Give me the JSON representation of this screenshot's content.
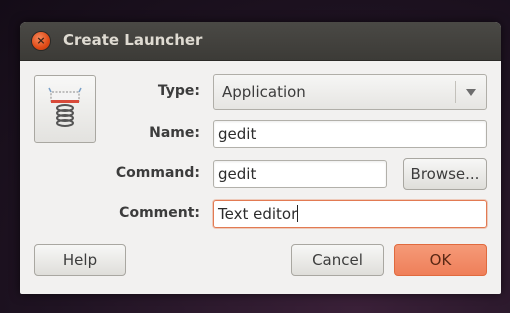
{
  "window": {
    "title": "Create Launcher",
    "close_glyph": "×"
  },
  "form": {
    "type_label": "Type:",
    "type_value": "Application",
    "name_label": "Name:",
    "name_value": "gedit",
    "command_label": "Command:",
    "command_value": "gedit",
    "comment_label": "Comment:",
    "comment_value": "Text editor"
  },
  "buttons": {
    "browse": "Browse...",
    "help": "Help",
    "cancel": "Cancel",
    "ok": "OK"
  },
  "icons": {
    "launcher": "spring-icon",
    "close": "close-icon",
    "dropdown": "chevron-down-icon"
  },
  "colors": {
    "accent": "#ef7f59",
    "focus_border": "#e27a52",
    "titlebar": "#3c3b37"
  }
}
